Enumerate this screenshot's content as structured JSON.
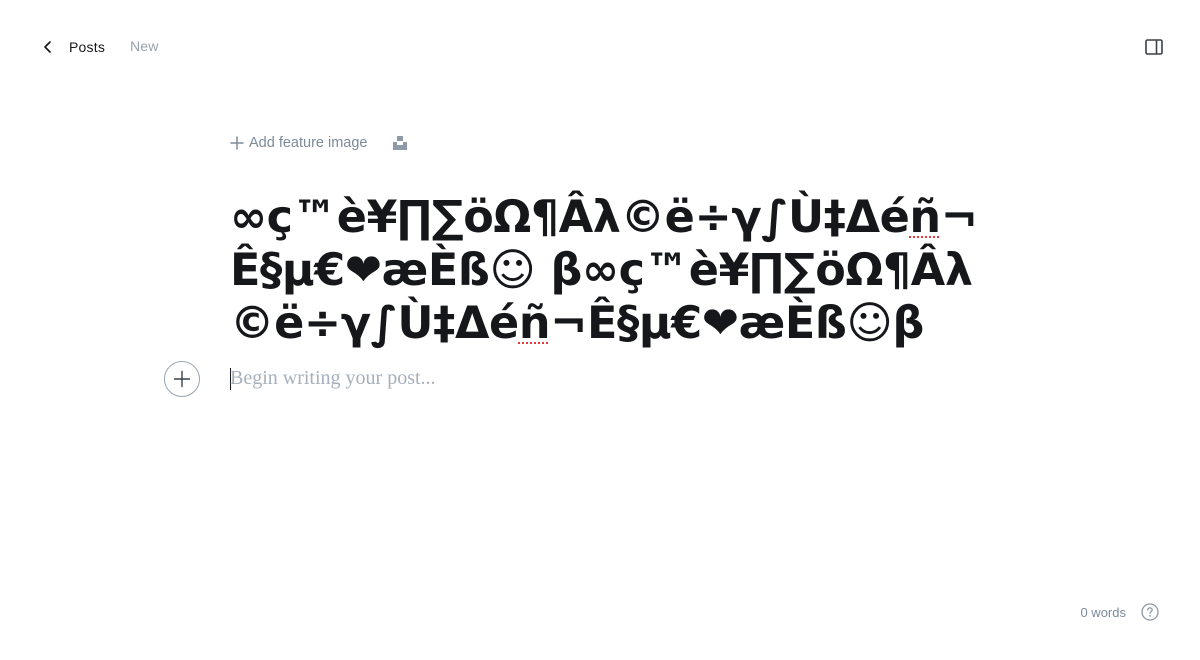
{
  "header": {
    "back_label": "Posts",
    "status": "New"
  },
  "icons": {
    "back": "chevron-left-icon",
    "settings": "sidebar-toggle-icon",
    "add_feature": "plus-icon",
    "unsplash": "unsplash-icon",
    "add_card": "plus-circle-icon",
    "help": "help-circle-icon"
  },
  "editor": {
    "add_feature_label": "Add feature image",
    "title_segments": [
      "∞ç™è¥∏∑öΩ¶Âλ©ë÷γ∫Ù‡Δé",
      "ñ",
      "¬Ê§µ€❤æÈß☺ β∞ç™è¥∏∑öΩ¶Âλ©ë÷γ∫Ù‡Δé",
      "ñ",
      "¬Ê§µ€❤æÈß☺β"
    ],
    "body_placeholder": "Begin writing your post..."
  },
  "footer": {
    "word_count": "0 words"
  },
  "colors": {
    "text": "#15171a",
    "muted": "#7c8b9a",
    "placeholder": "#a6b0ba",
    "spellcheck": "#e0393e"
  }
}
